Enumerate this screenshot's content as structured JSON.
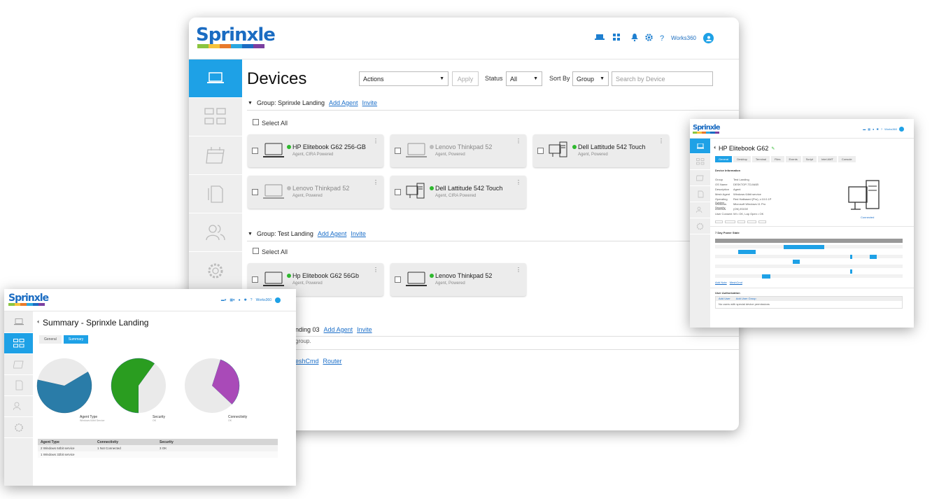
{
  "brand": {
    "name": "Sprinxle",
    "colors": [
      "#8bc53f",
      "#f6c33b",
      "#e8792b",
      "#2aa7df",
      "#1b6cc2",
      "#7b3fa0"
    ]
  },
  "header": {
    "user": "Works360",
    "icons": [
      "laptop-icon",
      "grid-icon",
      "bell-icon",
      "gear-icon",
      "help-icon"
    ]
  },
  "sidebar": {
    "icons": [
      "laptop-icon",
      "dashboard-icon",
      "calendar-icon",
      "documents-icon",
      "users-icon",
      "settings-icon"
    ]
  },
  "devices": {
    "title": "Devices",
    "actions": {
      "value": "Actions",
      "apply": "Apply"
    },
    "status": {
      "label": "Status",
      "value": "All"
    },
    "sort": {
      "label": "Sort By",
      "value": "Group"
    },
    "search": {
      "placeholder": "Search by Device"
    },
    "select_all": "Select All",
    "groups": [
      {
        "label": "Group: Sprinxle Landing",
        "add": "Add Agent",
        "invite": "Invite",
        "cards": [
          {
            "name": "HP Elitebook G62 256-GB",
            "sub": "Agent, CIRA Powered",
            "online": true,
            "kind": "laptop"
          },
          {
            "name": "Lenovo Thinkpad 52",
            "sub": "Agent, Powered",
            "online": false,
            "kind": "laptop"
          },
          {
            "name": "Dell Lattitude 542 Touch",
            "sub": "Agent, Powered",
            "online": true,
            "kind": "desktop"
          },
          {
            "name": "Lenovo Thinkpad 52",
            "sub": "Agent, Powered",
            "online": false,
            "kind": "laptop"
          },
          {
            "name": "Dell Lattitude 542 Touch",
            "sub": "Agent, CIRA Powered",
            "online": true,
            "kind": "desktop"
          }
        ]
      },
      {
        "label": "Group: Test Landing",
        "add": "Add Agent",
        "invite": "Invite",
        "cards": [
          {
            "name": "Hp Elitebook G62 56Gb",
            "sub": "Agent, Powered",
            "online": true,
            "kind": "laptop"
          },
          {
            "name": "Lenovo Thinkpad 52",
            "sub": "Agent, Powered",
            "online": true,
            "kind": "laptop"
          }
        ]
      }
    ],
    "group3": {
      "label_partial": "nding 03",
      "add": "Add Agent",
      "invite": "Invite",
      "note": "group."
    },
    "bottom_links": {
      "a": "eshCmd",
      "b": "Router"
    }
  },
  "summary": {
    "title": "Summary - Sprinxle Landing",
    "tabs": [
      "General",
      "Summary"
    ],
    "chart_data": [
      {
        "type": "pie",
        "title": "",
        "labels": [
          "Agent Type"
        ],
        "sublabel": "Windows 64bit Service",
        "colors": [
          "#2a7ca8",
          "#eaeaea"
        ],
        "values": [
          0.62,
          0.38
        ]
      },
      {
        "type": "pie",
        "title": "",
        "labels": [
          "Security"
        ],
        "sublabel": "OK",
        "colors": [
          "#2a9d20",
          "#eaeaea"
        ],
        "values": [
          0.6,
          0.4
        ]
      },
      {
        "type": "pie",
        "title": "",
        "labels": [
          "Connectivity"
        ],
        "sublabel": "OK",
        "colors": [
          "#a94ab8",
          "#eaeaea"
        ],
        "values": [
          0.32,
          0.68
        ]
      }
    ],
    "table": {
      "headers": [
        "Agent Type",
        "Connectivity",
        "Security"
      ],
      "rows": [
        [
          "2 Windows 64bit service",
          "1 Not Connected",
          "3 OK"
        ],
        [
          "1 Windows 32bit service",
          "",
          ""
        ]
      ]
    }
  },
  "detail": {
    "title": "HP Elitebook G62",
    "tabs": [
      "General",
      "Desktop",
      "Terminal",
      "Files",
      "Events",
      "Script",
      "Intel AMT",
      "Console"
    ],
    "section": "Device Information",
    "fields": [
      [
        "Group",
        "Test Landing"
      ],
      [
        "OS Name",
        "DESKTOP-TDJ4AEI"
      ],
      [
        "Description",
        "Agent"
      ],
      [
        "Mesh Agent",
        "Windows 64bit service"
      ],
      [
        "Operating System",
        "Red Hatbased (Pro), v.10.0.1P"
      ],
      [
        "Windows Security",
        "Microsoft Windows 11 Pro"
      ],
      [
        "Antivirus",
        "(ON) EDGE"
      ],
      [
        "User Consent",
        "Wi • OK, Lap Open • OK"
      ]
    ],
    "connected": "Connected",
    "power_title": "7 Day Power State",
    "power_rows": 7,
    "links": [
      "Add Note",
      "MeshCmd"
    ],
    "auth_title": "User Authorization",
    "auth_tabs": [
      "Add User",
      "Add User Group"
    ],
    "auth_note": "No users with special device permissions"
  }
}
